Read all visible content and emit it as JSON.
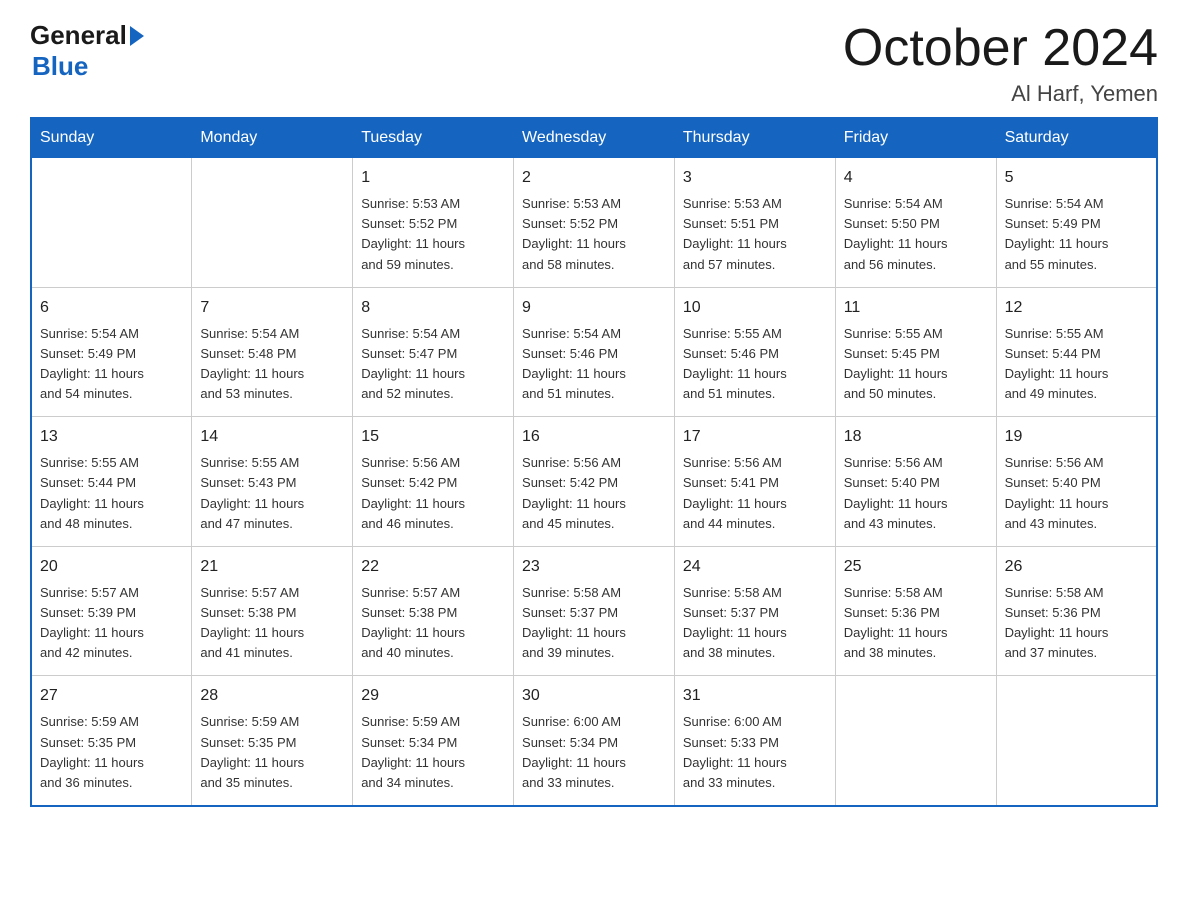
{
  "header": {
    "logo_general": "General",
    "logo_blue": "Blue",
    "month_title": "October 2024",
    "location": "Al Harf, Yemen"
  },
  "days_of_week": [
    "Sunday",
    "Monday",
    "Tuesday",
    "Wednesday",
    "Thursday",
    "Friday",
    "Saturday"
  ],
  "weeks": [
    [
      {
        "day": "",
        "info": ""
      },
      {
        "day": "",
        "info": ""
      },
      {
        "day": "1",
        "info": "Sunrise: 5:53 AM\nSunset: 5:52 PM\nDaylight: 11 hours\nand 59 minutes."
      },
      {
        "day": "2",
        "info": "Sunrise: 5:53 AM\nSunset: 5:52 PM\nDaylight: 11 hours\nand 58 minutes."
      },
      {
        "day": "3",
        "info": "Sunrise: 5:53 AM\nSunset: 5:51 PM\nDaylight: 11 hours\nand 57 minutes."
      },
      {
        "day": "4",
        "info": "Sunrise: 5:54 AM\nSunset: 5:50 PM\nDaylight: 11 hours\nand 56 minutes."
      },
      {
        "day": "5",
        "info": "Sunrise: 5:54 AM\nSunset: 5:49 PM\nDaylight: 11 hours\nand 55 minutes."
      }
    ],
    [
      {
        "day": "6",
        "info": "Sunrise: 5:54 AM\nSunset: 5:49 PM\nDaylight: 11 hours\nand 54 minutes."
      },
      {
        "day": "7",
        "info": "Sunrise: 5:54 AM\nSunset: 5:48 PM\nDaylight: 11 hours\nand 53 minutes."
      },
      {
        "day": "8",
        "info": "Sunrise: 5:54 AM\nSunset: 5:47 PM\nDaylight: 11 hours\nand 52 minutes."
      },
      {
        "day": "9",
        "info": "Sunrise: 5:54 AM\nSunset: 5:46 PM\nDaylight: 11 hours\nand 51 minutes."
      },
      {
        "day": "10",
        "info": "Sunrise: 5:55 AM\nSunset: 5:46 PM\nDaylight: 11 hours\nand 51 minutes."
      },
      {
        "day": "11",
        "info": "Sunrise: 5:55 AM\nSunset: 5:45 PM\nDaylight: 11 hours\nand 50 minutes."
      },
      {
        "day": "12",
        "info": "Sunrise: 5:55 AM\nSunset: 5:44 PM\nDaylight: 11 hours\nand 49 minutes."
      }
    ],
    [
      {
        "day": "13",
        "info": "Sunrise: 5:55 AM\nSunset: 5:44 PM\nDaylight: 11 hours\nand 48 minutes."
      },
      {
        "day": "14",
        "info": "Sunrise: 5:55 AM\nSunset: 5:43 PM\nDaylight: 11 hours\nand 47 minutes."
      },
      {
        "day": "15",
        "info": "Sunrise: 5:56 AM\nSunset: 5:42 PM\nDaylight: 11 hours\nand 46 minutes."
      },
      {
        "day": "16",
        "info": "Sunrise: 5:56 AM\nSunset: 5:42 PM\nDaylight: 11 hours\nand 45 minutes."
      },
      {
        "day": "17",
        "info": "Sunrise: 5:56 AM\nSunset: 5:41 PM\nDaylight: 11 hours\nand 44 minutes."
      },
      {
        "day": "18",
        "info": "Sunrise: 5:56 AM\nSunset: 5:40 PM\nDaylight: 11 hours\nand 43 minutes."
      },
      {
        "day": "19",
        "info": "Sunrise: 5:56 AM\nSunset: 5:40 PM\nDaylight: 11 hours\nand 43 minutes."
      }
    ],
    [
      {
        "day": "20",
        "info": "Sunrise: 5:57 AM\nSunset: 5:39 PM\nDaylight: 11 hours\nand 42 minutes."
      },
      {
        "day": "21",
        "info": "Sunrise: 5:57 AM\nSunset: 5:38 PM\nDaylight: 11 hours\nand 41 minutes."
      },
      {
        "day": "22",
        "info": "Sunrise: 5:57 AM\nSunset: 5:38 PM\nDaylight: 11 hours\nand 40 minutes."
      },
      {
        "day": "23",
        "info": "Sunrise: 5:58 AM\nSunset: 5:37 PM\nDaylight: 11 hours\nand 39 minutes."
      },
      {
        "day": "24",
        "info": "Sunrise: 5:58 AM\nSunset: 5:37 PM\nDaylight: 11 hours\nand 38 minutes."
      },
      {
        "day": "25",
        "info": "Sunrise: 5:58 AM\nSunset: 5:36 PM\nDaylight: 11 hours\nand 38 minutes."
      },
      {
        "day": "26",
        "info": "Sunrise: 5:58 AM\nSunset: 5:36 PM\nDaylight: 11 hours\nand 37 minutes."
      }
    ],
    [
      {
        "day": "27",
        "info": "Sunrise: 5:59 AM\nSunset: 5:35 PM\nDaylight: 11 hours\nand 36 minutes."
      },
      {
        "day": "28",
        "info": "Sunrise: 5:59 AM\nSunset: 5:35 PM\nDaylight: 11 hours\nand 35 minutes."
      },
      {
        "day": "29",
        "info": "Sunrise: 5:59 AM\nSunset: 5:34 PM\nDaylight: 11 hours\nand 34 minutes."
      },
      {
        "day": "30",
        "info": "Sunrise: 6:00 AM\nSunset: 5:34 PM\nDaylight: 11 hours\nand 33 minutes."
      },
      {
        "day": "31",
        "info": "Sunrise: 6:00 AM\nSunset: 5:33 PM\nDaylight: 11 hours\nand 33 minutes."
      },
      {
        "day": "",
        "info": ""
      },
      {
        "day": "",
        "info": ""
      }
    ]
  ]
}
